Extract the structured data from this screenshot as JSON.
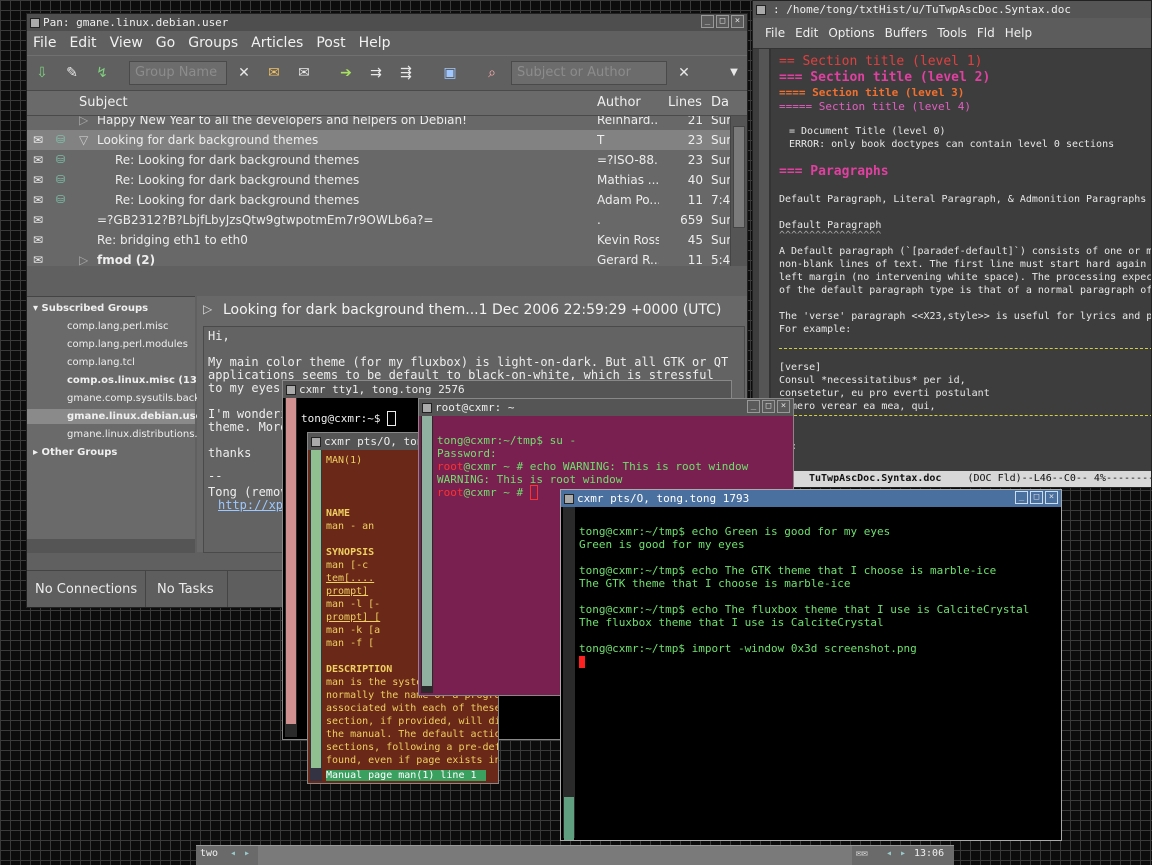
{
  "pan": {
    "title": "Pan: gmane.linux.debian.user",
    "menu": [
      "File",
      "Edit",
      "View",
      "Go",
      "Groups",
      "Articles",
      "Post",
      "Help"
    ],
    "group_search_placeholder": "Group Name",
    "article_search_placeholder": "Subject or Author",
    "headers": {
      "subject": "Subject",
      "author": "Author",
      "lines": "Lines",
      "date": "Da"
    },
    "articles": [
      {
        "subject": "Happy New Year to all the developers and helpers on Debian!",
        "author": "Reinhard...",
        "lines": "21",
        "date": "Sur"
      },
      {
        "subject": "Looking for dark background themes",
        "author": "T",
        "lines": "23",
        "date": "Sur"
      },
      {
        "subject": "Re: Looking for dark background themes",
        "author": "=?ISO-88...",
        "lines": "23",
        "date": "Sur"
      },
      {
        "subject": "Re: Looking for dark background themes",
        "author": "Mathias ...",
        "lines": "40",
        "date": "Sur"
      },
      {
        "subject": "Re: Looking for dark background themes",
        "author": "Adam Po...",
        "lines": "11",
        "date": "7:4"
      },
      {
        "subject": "=?GB2312?B?LbjfLbyJzsQtw9gtwpotmEm7r9OWLb6a?=",
        "author": ".",
        "lines": "659",
        "date": "Sur"
      },
      {
        "subject": "Re: bridging eth1 to eth0",
        "author": "Kevin Ross",
        "lines": "45",
        "date": "Sur"
      },
      {
        "subject": "fmod (2)",
        "author": "Gerard R...",
        "lines": "11",
        "date": "5:4"
      }
    ],
    "groups_header": "Subscribed Groups",
    "groups": [
      "comp.lang.perl.misc",
      "comp.lang.perl.modules",
      "comp.lang.tcl",
      "comp.os.linux.misc (13",
      "gmane.comp.sysutils.back",
      "gmane.linux.debian.user",
      "gmane.linux.distributions.",
      "Other Groups"
    ],
    "message_header": "Looking for dark background them...1 Dec 2006 22:59:29 +0000 (UTC)",
    "message_lines": [
      "Hi,",
      "My main color theme (for my fluxbox) is light-on-dark. But all GTK or QT",
      "applications seems to be default to black-on-white, which is stressful",
      "to my eyes.",
      "I'm wonderi",
      "theme. More",
      "thanks",
      "--",
      "Tong (remov",
      "http://xp"
    ],
    "status_connections": "No Connections",
    "status_tasks": "No Tasks"
  },
  "emacs": {
    "title": ": /home/tong/txtHist/u/TuTwpAscDoc.Syntax.doc",
    "menu": [
      "File",
      "Edit",
      "Options",
      "Buffers",
      "Tools",
      "Fld",
      "Help"
    ],
    "lines": [
      "== Section title (level 1)",
      "=== Section title (level 2)",
      "==== Section title (level 3)",
      "===== Section title (level 4)",
      "= Document Title (level 0)",
      "ERROR: only book doctypes can contain level 0 sections",
      "=== Paragraphs",
      "Default Paragraph, Literal Paragraph, & Admonition Paragraphs",
      "Default Paragraph",
      "^^^^^^^^^^^^^^^^^",
      "A Default paragraph (`[paradef-default]`) consists of one or m",
      "non-blank lines of text.  The first line must start hard again",
      "left margin (no intervening white space). The processing expec",
      "of the default paragraph type is that of a normal paragraph of",
      "The 'verse' paragraph <<X23,style>> is useful for lyrics and p",
      "For example:",
      "[verse]",
      "Consul *necessitatibus* per id,",
      "consetetur, eu pro everti postulant",
      "homero verear ea mea, qui,",
      "rs:"
    ],
    "modeline_file": "TuTwpAscDoc.Syntax.doc",
    "modeline_info": "(DOC Fld)--L46--C0-- 4%---------"
  },
  "tty1": {
    "title": "cxmr tty1, tong.tong 2576",
    "prompt": "tong@cxmr:~$"
  },
  "man": {
    "title": "cxmr pts/O, tong",
    "lines": [
      {
        "t": "MAN(1)",
        "c": "#f0d060"
      },
      {
        "t": "NAME",
        "c": "#f0d060"
      },
      {
        "t": "       man - an",
        "c": "#f0d060"
      },
      {
        "t": "SYNOPSIS",
        "c": "#f0d060"
      },
      {
        "t": "       man  [-c",
        "c": "#f0d060"
      },
      {
        "t": "       tem[....",
        "c": "#f0d060"
      },
      {
        "t": "       prompt] ",
        "c": "#f0d060"
      },
      {
        "t": "       man -l [-",
        "c": "#f0d060"
      },
      {
        "t": "       prompt] [",
        "c": "#f0d060"
      },
      {
        "t": "       man -k [a",
        "c": "#f0d060"
      },
      {
        "t": "       man -f [",
        "c": "#f0d060"
      },
      {
        "t": "DESCRIPTION",
        "c": "#f0d060"
      },
      {
        "t": "       man is the system's manual pager",
        "c": "#f0d060"
      },
      {
        "t": "       normally  the  name of a program",
        "c": "#f0d060"
      },
      {
        "t": "       associated with each of these ar",
        "c": "#f0d060"
      },
      {
        "t": "       section,  if  provided, will dir",
        "c": "#f0d060"
      },
      {
        "t": "       the manual.  The default action ",
        "c": "#f0d060"
      },
      {
        "t": "       sections, following a pre-define",
        "c": "#f0d060"
      },
      {
        "t": "       found, even if page exists in se",
        "c": "#f0d060"
      }
    ],
    "status": " Manual page man(1) line 1"
  },
  "root": {
    "title": "root@cxmr: ~",
    "lines": [
      {
        "p": "",
        "t": "tong@cxmr:~/tmp$ su -"
      },
      {
        "p": "",
        "t": "Password:"
      },
      {
        "p": "root",
        "t": "@cxmr ~ # echo WARNING: This is root window"
      },
      {
        "p": "",
        "t": "WARNING: This is root window"
      },
      {
        "p": "root",
        "t": "@cxmr ~ # "
      }
    ]
  },
  "green": {
    "title": "cxmr pts/O, tong.tong 1793",
    "lines": [
      "tong@cxmr:~/tmp$ echo Green is good for my eyes",
      "Green is good for my eyes",
      "",
      "tong@cxmr:~/tmp$ echo The GTK theme that I choose is marble-ice",
      "The GTK theme that I choose is marble-ice",
      "",
      "tong@cxmr:~/tmp$ echo The fluxbox theme that I use is CalciteCrystal",
      "The fluxbox theme that I use is CalciteCrystal",
      "",
      "tong@cxmr:~/tmp$ import -window 0x3d screenshot.png"
    ]
  },
  "taskbar": {
    "workspace": "two",
    "clock": "13:06"
  },
  "colors": {
    "green_text": "#6ee06e",
    "root_red": "#ff3030",
    "section1": "#e04040",
    "section2": "#e040a0",
    "section3": "#f07030"
  }
}
